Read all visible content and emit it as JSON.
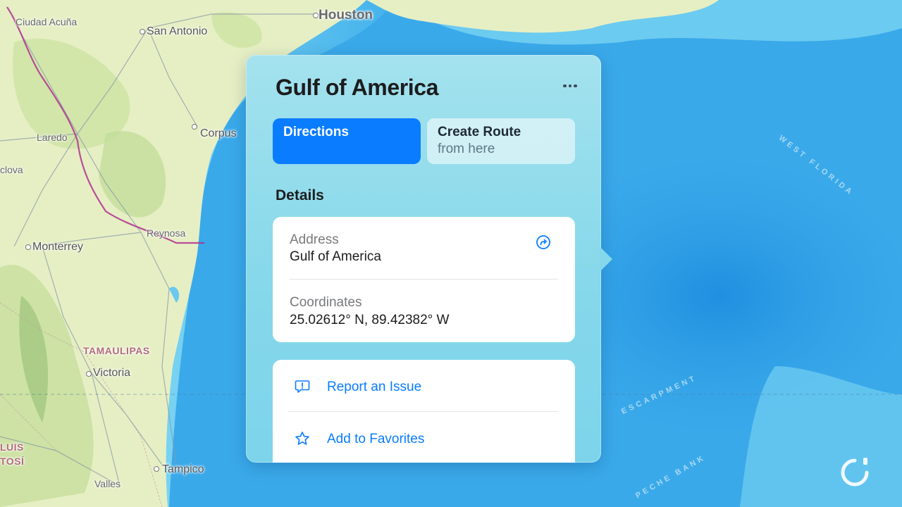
{
  "map": {
    "labels": {
      "houston": "Houston",
      "ciudad_acuna": "Ciudad Acuña",
      "san_antonio": "San Antonio",
      "corpus": "Corpus",
      "laredo": "Laredo",
      "clova": "clova",
      "reynosa": "Reynosa",
      "monterrey": "Monterrey",
      "tamaulipas": "TAMAULIPAS",
      "victoria": "Victoria",
      "luis": "LUIS",
      "tosi": "TOSÍ",
      "tampico": "Tampico",
      "valles": "Valles",
      "west_florida": "WEST FLORIDA",
      "escarpment": "ESCARPMENT",
      "peche_bank": "PECHE BANK"
    },
    "colors": {
      "land": "#e8f0c6",
      "water": "#37a7e8",
      "border": "#b0308f"
    }
  },
  "popover": {
    "title": "Gulf of America",
    "more_icon": "ellipsis-icon",
    "directions_label": "Directions",
    "create_route_label": "Create Route",
    "create_route_sub": "from here",
    "details_heading": "Details",
    "address_label": "Address",
    "address_value": "Gulf of America",
    "coords_label": "Coordinates",
    "coords_value": "25.02612° N, 89.42382° W",
    "share_icon": "share-arrow-icon",
    "report_label": "Report an Issue",
    "report_icon": "exclamation-bubble-icon",
    "favorites_label": "Add to Favorites",
    "favorites_icon": "star-icon"
  },
  "accent_color": "#0a7cff"
}
